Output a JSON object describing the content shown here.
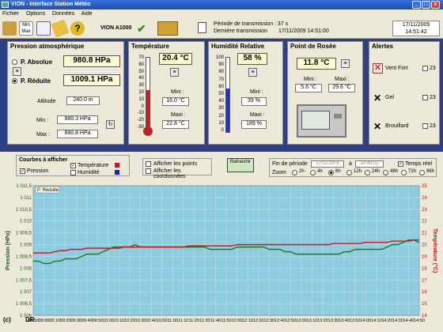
{
  "window": {
    "title": "VION - Interface Station Météo"
  },
  "menu": [
    "Fichier",
    "Options",
    "Données",
    "Aide"
  ],
  "toolbar": {
    "minmax_label": "Min Max",
    "model": "VION A1000",
    "period_label": "Période de transmission : 37 s",
    "last_tx_label": "Dernière transmission",
    "last_tx_value": "17/11/2009 14:51:00",
    "date": "17/11/2009",
    "time": "14:51:42"
  },
  "pressure": {
    "title": "Pression atmosphérique",
    "absolue_label": "P. Absolue",
    "absolue_value": "980.8 HPa",
    "reduite_label": "P. Réduite",
    "reduite_value": "1009.1 HPa",
    "altitude_label": "Altitude",
    "altitude_value": "240.0 m",
    "min_label": "Min :",
    "min_value": "980.3 HPa",
    "max_label": "Max :",
    "max_value": "980.8 HPa"
  },
  "temperature": {
    "title": "Température",
    "value": "20.4 °C",
    "scale": [
      "70",
      "60",
      "50",
      "40",
      "30",
      "20",
      "10",
      "0",
      "-10",
      "-20",
      "-30"
    ],
    "level": 0.53,
    "mini_label": "Mini :",
    "mini_value": "16.0 °C",
    "maxi_label": "Maxi :",
    "maxi_value": "22.8 °C"
  },
  "humidity": {
    "title": "Humidité Relative",
    "value": "58 %",
    "scale": [
      "100",
      "90",
      "80",
      "70",
      "60",
      "50",
      "40",
      "30",
      "20",
      "10",
      "0"
    ],
    "level": 0.58,
    "mini_label": "Mini :",
    "mini_value": "39 %",
    "maxi_label": "Maxi :",
    "maxi_value": "189 %"
  },
  "dewpoint": {
    "title": "Point de Rosée",
    "value": "11.8 °C",
    "mini_label": "Mini :",
    "mini_value": "5.6 °C",
    "maxi_label": "Maxi :",
    "maxi_value": "29.6 °C"
  },
  "alerts": {
    "title": "Alertes",
    "items": [
      {
        "label": "Vent Fort",
        "value": "23"
      },
      {
        "label": "Gel",
        "value": "23"
      },
      {
        "label": "Brouillard",
        "value": "23"
      }
    ]
  },
  "controls": {
    "curves_title": "Courbes à afficher",
    "pressure_label": "Pression",
    "temperature_label": "Température",
    "humidity_label": "Humidité",
    "points_label": "Afficher les points",
    "coords_label": "Afficher les coordonnées",
    "refresh_label": "Rafraîchir",
    "period_end_label": "Fin de période",
    "period_date": "17/11/2009",
    "period_sep": "à",
    "period_time": "14:49:02",
    "realtime_label": "Temps réel",
    "zoom_label": "Zoom",
    "zoom_options": [
      "2h",
      "4h",
      "6h",
      "12h",
      "24h",
      "48h",
      "72h",
      "96h"
    ],
    "zoom_selected": "6h"
  },
  "colors": {
    "pressure": "#1a7a1a",
    "temperature": "#dd1111",
    "humidity": "#1122bb",
    "plot_bg": "#8ecde0"
  },
  "chart_data": {
    "type": "line",
    "x": [
      "08:50",
      "08:55",
      "09:00",
      "09:05",
      "09:10",
      "09:15",
      "09:20",
      "09:25",
      "09:30",
      "09:35",
      "09:40",
      "09:45",
      "09:50",
      "09:55",
      "10:00",
      "10:05",
      "10:10",
      "10:15",
      "10:20",
      "10:25",
      "10:30",
      "10:35",
      "10:40",
      "10:45",
      "10:50",
      "10:55",
      "11:00",
      "11:05",
      "11:10",
      "11:15",
      "11:20",
      "11:25",
      "11:30",
      "11:35",
      "11:40",
      "11:45",
      "11:50",
      "11:55",
      "12:00",
      "12:05",
      "12:10",
      "12:15",
      "12:20",
      "12:25",
      "12:30",
      "12:35",
      "12:40",
      "12:45",
      "12:50",
      "12:55",
      "13:00",
      "13:05",
      "13:10",
      "13:15",
      "13:20",
      "13:25",
      "13:30",
      "13:35",
      "13:40",
      "13:45",
      "13:50",
      "13:55",
      "14:00",
      "14:05",
      "14:10",
      "14:15",
      "14:20",
      "14:25",
      "14:30",
      "14:35",
      "14:40",
      "14:45",
      "14:50"
    ],
    "series": [
      {
        "name": "Pression",
        "axis": "left",
        "values": [
          1008.3,
          1008.3,
          1008.2,
          1008.2,
          1008.3,
          1008.3,
          1008.4,
          1008.4,
          1008.4,
          1008.5,
          1008.6,
          1008.6,
          1008.6,
          1008.7,
          1008.8,
          1008.9,
          1008.9,
          1008.9,
          1008.9,
          1009.0,
          1008.9,
          1008.9,
          1008.9,
          1008.9,
          1008.9,
          1008.9,
          1008.9,
          1008.9,
          1008.9,
          1008.9,
          1008.9,
          1008.9,
          1008.9,
          1008.8,
          1008.8,
          1008.8,
          1008.8,
          1008.8,
          1008.9,
          1008.9,
          1008.9,
          1008.9,
          1008.9,
          1008.9,
          1008.8,
          1008.8,
          1008.8,
          1008.7,
          1008.7,
          1008.6,
          1008.6,
          1008.6,
          1008.6,
          1008.6,
          1008.6,
          1008.6,
          1008.6,
          1008.6,
          1008.7,
          1008.7,
          1008.8,
          1008.8,
          1008.8,
          1008.8,
          1008.8,
          1008.8,
          1008.9,
          1009.0,
          1009.0,
          1009.1,
          1009.2,
          1009.2,
          1009.1
        ]
      },
      {
        "name": "Température",
        "axis": "right",
        "values": [
          19.3,
          19.3,
          19.3,
          19.3,
          19.4,
          19.5,
          19.5,
          19.6,
          19.6,
          19.6,
          19.7,
          19.7,
          19.7,
          19.7,
          19.7,
          19.7,
          19.7,
          19.8,
          19.8,
          19.8,
          19.8,
          19.8,
          19.8,
          19.8,
          19.8,
          19.8,
          19.8,
          19.8,
          19.8,
          19.9,
          19.9,
          19.9,
          19.9,
          19.9,
          19.9,
          19.9,
          19.9,
          19.9,
          20.0,
          20.0,
          20.0,
          20.0,
          20.0,
          20.0,
          20.0,
          20.0,
          20.0,
          20.0,
          20.0,
          20.0,
          20.0,
          20.0,
          20.0,
          20.0,
          20.0,
          20.0,
          20.1,
          20.1,
          20.1,
          20.1,
          20.1,
          20.1,
          20.2,
          20.2,
          20.2,
          20.2,
          20.2,
          20.3,
          20.3,
          20.3,
          20.3,
          20.4,
          20.4
        ]
      }
    ],
    "ylabel": "Pression (HPa)",
    "y2label": "Température (°C)",
    "ylim": [
      1008.0,
      1011.5
    ],
    "y2lim": [
      14,
      25
    ],
    "yticks": [
      "1 011,5",
      "1 011",
      "1 010,5",
      "1 010",
      "1 009,5",
      "1 009",
      "1 008,5",
      "1 008",
      "1 007,5",
      "1 007",
      "1 006,5",
      "1 006"
    ],
    "y2ticks": [
      "25",
      "24",
      "23",
      "22",
      "21",
      "20",
      "19",
      "18",
      "17",
      "16",
      "15",
      "14"
    ],
    "xticks": [
      "08:50",
      "09:00",
      "09:10",
      "09:20",
      "09:30",
      "09:40",
      "09:50",
      "10:00",
      "10:10",
      "10:20",
      "10:30",
      "10:40",
      "10:50",
      "11:00",
      "11:10",
      "11:20",
      "11:30",
      "11:40",
      "11:50",
      "12:00",
      "12:10",
      "12:20",
      "12:30",
      "12:40",
      "12:50",
      "13:00",
      "13:10",
      "13:20",
      "13:30",
      "13:40",
      "13:50",
      "14:00",
      "14:10",
      "14:20",
      "14:30",
      "14:40",
      "14:50"
    ],
    "legend_tag": "P. Réduite",
    "corner_label": "DR",
    "copyright": "(c)"
  }
}
